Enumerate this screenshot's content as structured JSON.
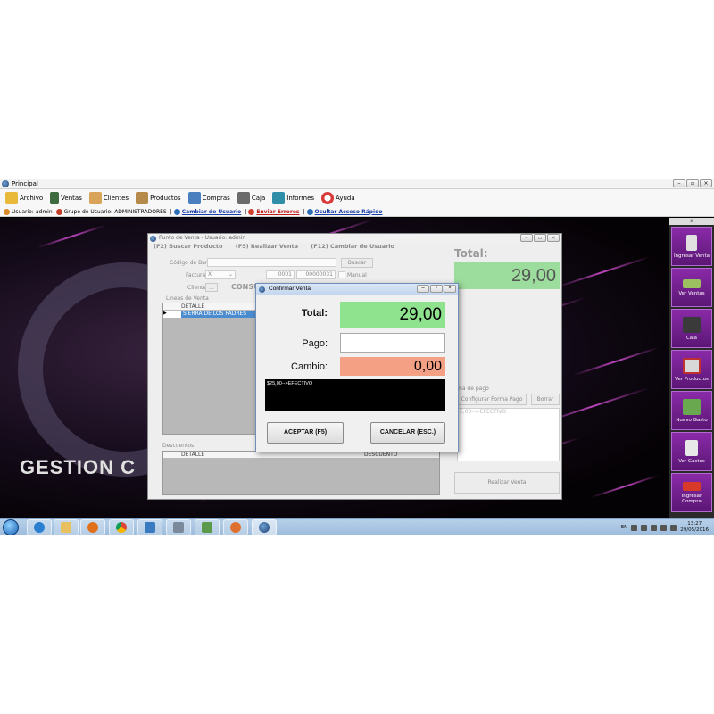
{
  "window": {
    "title": "Principal"
  },
  "menu": [
    {
      "label": "Archivo",
      "icon": "folder-icon",
      "color": "#e8b93a"
    },
    {
      "label": "Ventas",
      "icon": "calculator-icon",
      "color": "#3d6b3d"
    },
    {
      "label": "Clientes",
      "icon": "handshake-icon",
      "color": "#d9a45a"
    },
    {
      "label": "Productos",
      "icon": "box-icon",
      "color": "#b58a4a"
    },
    {
      "label": "Compras",
      "icon": "cart-icon",
      "color": "#4a7fbf"
    },
    {
      "label": "Caja",
      "icon": "cash-register-icon",
      "color": "#6a6a6a"
    },
    {
      "label": "Informes",
      "icon": "chart-icon",
      "color": "#2f8fa8"
    },
    {
      "label": "Ayuda",
      "icon": "lifebuoy-icon",
      "color": "#d83a3a"
    }
  ],
  "quick": {
    "user_label": "Usuario:",
    "user_value": "admin",
    "group_label": "Grupo de Usuario:",
    "group_value": "ADMINISTRADORES",
    "change_user": "Cambiar de Usuario",
    "send_errors": "Enviar Errores",
    "hide_quick": "Ocultar Acceso Rápido"
  },
  "desktop": {
    "brand_text": "GESTION C"
  },
  "sidebar": {
    "close": "x",
    "items": [
      {
        "label": "Ingresar Venta",
        "icon": "pos-terminal-icon"
      },
      {
        "label": "Ver Ventas",
        "icon": "cash-bills-icon"
      },
      {
        "label": "Caja",
        "icon": "cash-register-icon"
      },
      {
        "label": "Ver Productos",
        "icon": "products-icon"
      },
      {
        "label": "Nuevo Gasto",
        "icon": "money-icon"
      },
      {
        "label": "Ver Gastos",
        "icon": "receipt-icon"
      },
      {
        "label": "Ingresar Compra",
        "icon": "truck-icon"
      }
    ]
  },
  "pv": {
    "title": "Punto de Venta - Usuario: admin",
    "shortcut_f2": "(F2) Buscar Producto",
    "shortcut_f5": "(F5) Realizar Venta",
    "shortcut_f12": "(F12) Cambiar de Usuario",
    "barcode_label": "Código de Barra",
    "search_btn": "Buscar",
    "invoice_label": "Factura",
    "invoice_type": "X",
    "invoice_point": "0001",
    "invoice_number": "00000031",
    "manual_label": "Manual",
    "client_label": "Cliente",
    "client_btn": "...",
    "client_value": "CONSU",
    "lines_label": "Lineas de Venta",
    "lines_header": "DETALLE",
    "lines_row": "SIERRA DE LOS PADRES",
    "discounts_label": "Descuentos",
    "discount_col_detail": "DETALLE",
    "discount_col_amount": "DESCUENTO",
    "total_label": "Total:",
    "total_value": "29,00",
    "payment_label": "ma de pago",
    "config_payment_btn": "Configurar Forma Pago",
    "delete_btn": "Borrar",
    "payment_line": "5,00-->EFECTIVO",
    "submit_btn": "Realizar Venta"
  },
  "dialog": {
    "title": "Confirmar Venta",
    "total_label": "Total:",
    "total_value": "29,00",
    "pay_label": "Pago:",
    "pay_value": "",
    "change_label": "Cambio:",
    "change_value": "0,00",
    "log": "$25,00-->EFECTIVO",
    "accept_btn": "ACEPTAR (F5)",
    "cancel_btn": "CANCELAR (ESC.)",
    "colors": {
      "total_bg": "#8fe38f",
      "change_bg": "#f4a085",
      "log_bg": "#000000"
    }
  },
  "taskbar": {
    "lang": "EN",
    "time": "13:27",
    "date": "29/05/2016"
  }
}
